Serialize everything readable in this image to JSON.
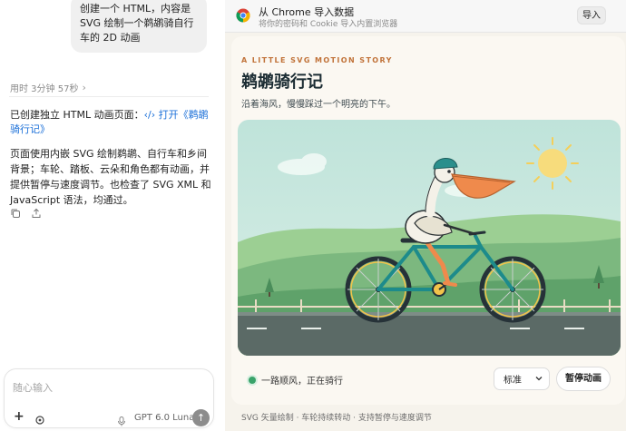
{
  "chat": {
    "user_message": "创建一个 HTML，内容是 SVG 绘制一个鹈鹕骑自行车的 2D 动画",
    "elapsed": "用时 3分钟 57秒",
    "created_prefix": "已创建独立 HTML 动画页面：",
    "created_link": "‹/› 打开《鹈鹕骑行记》",
    "summary": "页面使用内嵌 SVG 绘制鹈鹕、自行车和乡间背景；车轮、踏板、云朵和角色都有动画，并提供暂停与速度调节。也检查了 SVG XML 和 JavaScript 语法，均通过。",
    "composer_placeholder": "随心输入",
    "model_name": "GPT 6.0 Luna"
  },
  "import_bar": {
    "title": "从 Chrome 导入数据",
    "subtitle": "将你的密码和 Cookie 导入内置浏览器",
    "button": "导入"
  },
  "story": {
    "kicker": "A LITTLE SVG MOTION STORY",
    "title": "鹈鹕骑行记",
    "subtitle": "沿着海风，慢慢踩过一个明亮的下午。",
    "status": "一路顺风，正在骑行",
    "speed_selected": "标准",
    "pause_button": "暂停动画",
    "footnote": "SVG 矢量绘制 · 车轮持续转动 · 支持暂停与速度调节"
  },
  "colors": {
    "sky": "#bfe3da",
    "sun": "#f7dc7c",
    "hills": "#7cb87f",
    "road": "#5b6a66",
    "bike_frame": "#1d8b8b",
    "helmet": "#2a8f8c",
    "beak": "#ef8a4c",
    "accent": "#c1733a",
    "status_green": "#3aa36a"
  },
  "icons": [
    "chevron-right-icon",
    "copy-icon",
    "share-icon",
    "chrome-icon",
    "plus-icon",
    "settings-icon",
    "mic-icon",
    "arrow-up-icon",
    "chevron-down-icon"
  ]
}
